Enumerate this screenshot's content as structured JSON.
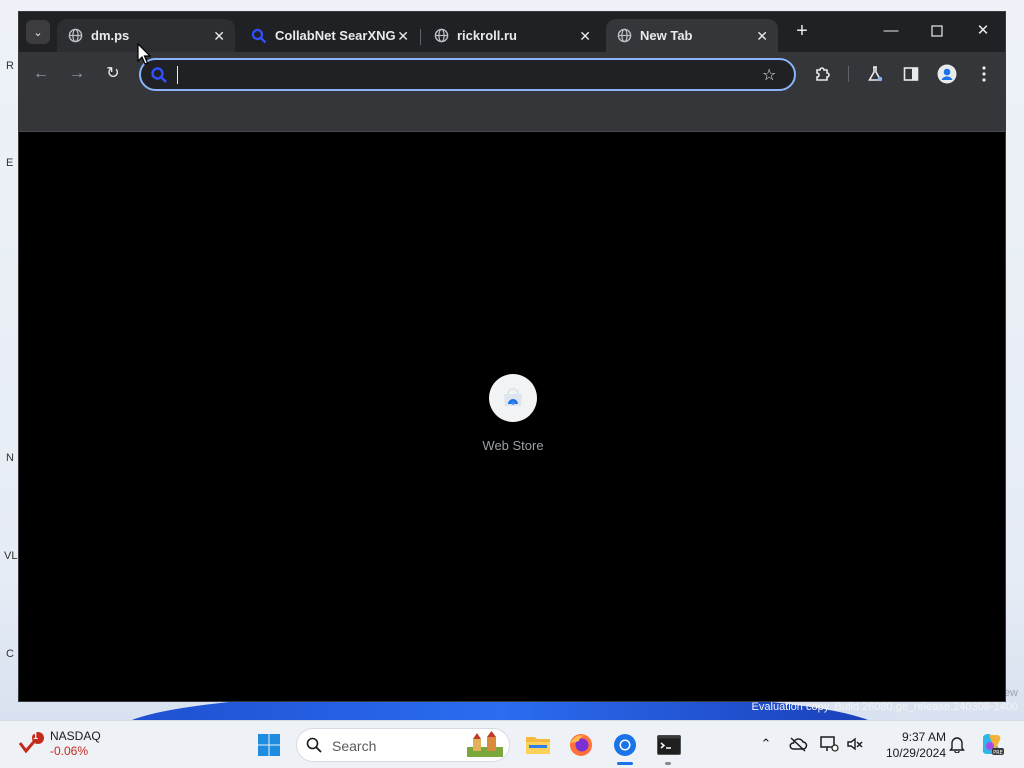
{
  "browser": {
    "tabs": [
      {
        "title": "dm.ps",
        "icon": "globe-icon",
        "state": "hover"
      },
      {
        "title": "CollabNet SearXNG",
        "icon": "search-icon",
        "state": "inactive"
      },
      {
        "title": "rickroll.ru",
        "icon": "globe-icon",
        "state": "inactive"
      },
      {
        "title": "New Tab",
        "icon": "globe-icon",
        "state": "active"
      }
    ],
    "omnibox": {
      "value": "",
      "placeholder": ""
    },
    "shortcuts": [
      {
        "label": "Web Store",
        "icon": "web-store-icon"
      }
    ],
    "accent_color": "#8ab4f8"
  },
  "desktop": {
    "left_edge_letters": [
      "R",
      "E",
      "N",
      "VL",
      "C"
    ],
    "watermark_line1": "ew",
    "watermark_line2": "Evaluation copy. Build 26080.ge_release.240308-1400"
  },
  "taskbar": {
    "widget": {
      "name": "NASDAQ",
      "value": "-0.06%",
      "badge": "1",
      "value_color": "#c42b1c"
    },
    "search": {
      "placeholder": "Search"
    },
    "clock": {
      "time": "9:37 AM",
      "date": "10/29/2024"
    }
  }
}
